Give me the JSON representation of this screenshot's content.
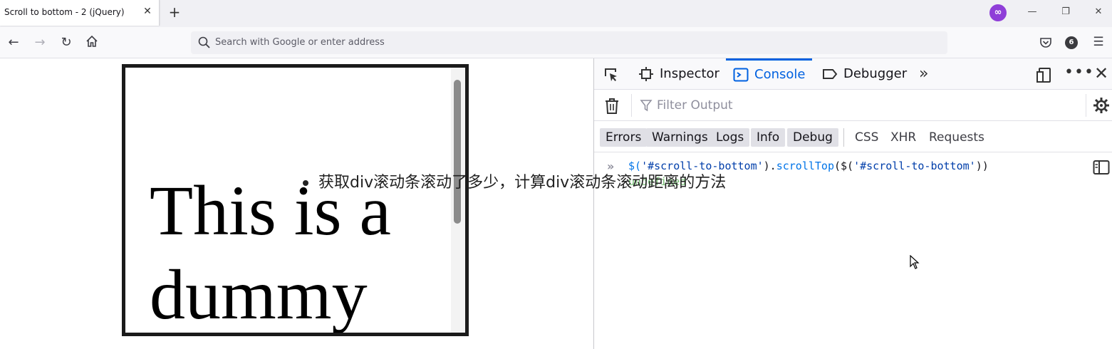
{
  "browser": {
    "tab_title": "Scroll to bottom - 2 (jQuery)",
    "tab_close": "✕",
    "new_tab": "+",
    "window_minimize": "—",
    "window_restore": "❐",
    "window_close": "✕",
    "url_placeholder": "Search with Google or enter address",
    "extension_badge": "6",
    "account_icon": "private-browsing-icon",
    "accent_color": "#0061e0"
  },
  "page": {
    "scroll_text_line1": "This is a",
    "scroll_text_line2": "dummy",
    "overlay_caption": "获取div滚动条滚动了多少，计算div滚动条滚动距离的方法"
  },
  "devtools": {
    "tabs": [
      {
        "label": "Inspector",
        "icon": "inspector-icon"
      },
      {
        "label": "Console",
        "icon": "console-icon",
        "selected": true
      },
      {
        "label": "Debugger",
        "icon": "debugger-icon"
      }
    ],
    "more_tabs": "»",
    "filter_placeholder": "Filter Output",
    "levels": [
      {
        "label": "Errors",
        "on": true
      },
      {
        "label": "Warnings",
        "on": true
      },
      {
        "label": "Logs",
        "on": true
      },
      {
        "label": "Info",
        "on": true
      },
      {
        "label": "Debug",
        "on": true
      }
    ],
    "request_filters": [
      "CSS",
      "XHR",
      "Requests"
    ],
    "console": {
      "cmd_part1": "$(",
      "cmd_part2": "'#scroll-to-bottom'",
      "cmd_part3": ").",
      "cmd_part4": "scrollTop",
      "cmd_part5": "($(",
      "cmd_part6": "'#scroll-to-bottom'",
      "cmd_part7": "))",
      "result": "undefined"
    }
  }
}
